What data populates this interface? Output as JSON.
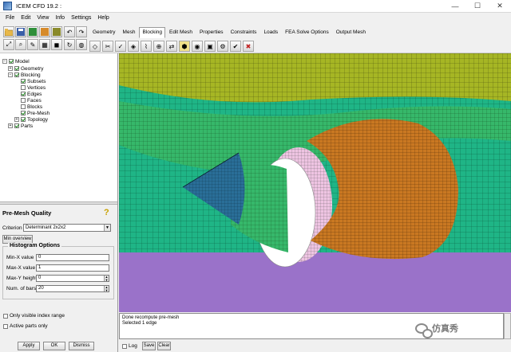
{
  "window": {
    "title": "ICEM CFD 19.2 :",
    "minimize": "—",
    "maximize": "☐",
    "close": "✕"
  },
  "menu": [
    "File",
    "Edit",
    "View",
    "Info",
    "Settings",
    "Help"
  ],
  "tabs": [
    "Geometry",
    "Mesh",
    "Blocking",
    "Edit Mesh",
    "Properties",
    "Constraints",
    "Loads",
    "FEA Solve Options",
    "Output Mesh"
  ],
  "active_tab": "Blocking",
  "tree": {
    "root": "Model",
    "items": [
      {
        "label": "Geometry",
        "checked": true
      },
      {
        "label": "Blocking",
        "checked": true
      },
      {
        "label": "Subsets",
        "checked": true
      },
      {
        "label": "Vertices",
        "checked": false
      },
      {
        "label": "Edges",
        "checked": true
      },
      {
        "label": "Faces",
        "checked": false
      },
      {
        "label": "Blocks",
        "checked": false
      },
      {
        "label": "Pre-Mesh",
        "checked": true
      },
      {
        "label": "Topology",
        "checked": true
      },
      {
        "label": "Parts",
        "checked": true
      }
    ]
  },
  "panel": {
    "title": "Pre-Mesh Quality",
    "help": "?",
    "criterion_label": "Criterion",
    "criterion_value": "Determinant 2x2x2",
    "min_overview": "Min overview",
    "histogram_title": "Histogram Options",
    "min_x_label": "Min-X value",
    "min_x_value": "0",
    "max_x_label": "Max-X value",
    "max_x_value": "1",
    "max_y_label": "Max-Y height",
    "max_y_value": "0",
    "bars_label": "Num. of bars",
    "bars_value": "20",
    "only_visible": "Only visible index range",
    "active_parts": "Active parts only",
    "apply": "Apply",
    "ok": "OK",
    "dismiss": "Dismiss"
  },
  "messages": [
    "Done recompute pre-mesh",
    "Selected 1 edge"
  ],
  "bottom": {
    "log": "Log",
    "save": "Save",
    "clear": "Clear"
  },
  "watermark": "仿真秀",
  "colors": {
    "mesh_green": "#1fb586",
    "nacelle_orange": "#c97822",
    "ground_purple": "#9a72c9",
    "cone_blue": "#2a6e98"
  }
}
